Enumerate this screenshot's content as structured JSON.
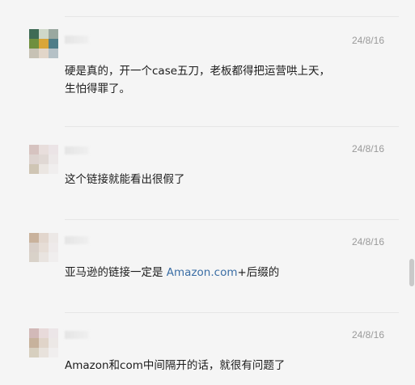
{
  "comments": [
    {
      "date": "24/8/16",
      "text": "硬是真的，开一个case五刀，老板都得把运营哄上天，生怕得罪了。",
      "avatar_colors": [
        "#3f6b55",
        "#cfd8c9",
        "#9aa8a0",
        "#6f8f3f",
        "#d9a63a",
        "#4f7d88",
        "#c7c2b5",
        "#e2d6c9",
        "#b5c1c6"
      ]
    },
    {
      "date": "24/8/16",
      "text": "这个链接就能看出很假了",
      "avatar_colors": [
        "#d6c3c0",
        "#e8dedc",
        "#ebe4e6",
        "#ddd3cf",
        "#e0d8d4",
        "#ece8e8",
        "#cfc5b4",
        "#ebe6e2",
        "#f0eeee"
      ]
    },
    {
      "date": "24/8/16",
      "text_before": "亚马逊的链接一定是 ",
      "link": "Amazon.com",
      "text_after": "+后缀的",
      "avatar_colors": [
        "#c9b29c",
        "#e2d6cd",
        "#ece8e6",
        "#d8cfc8",
        "#e6ddd6",
        "#eeeaea",
        "#d9d2c9",
        "#e9e4e0",
        "#f0eeee"
      ]
    },
    {
      "date": "24/8/16",
      "text": "Amazon和com中间隔开的话，就很有问题了",
      "avatar_colors": [
        "#d2b9b8",
        "#e8dada",
        "#ece6e8",
        "#c7b29c",
        "#e0d4c9",
        "#ece8e6",
        "#d7cfbf",
        "#e8e2dc",
        "#f0eeee"
      ]
    }
  ]
}
